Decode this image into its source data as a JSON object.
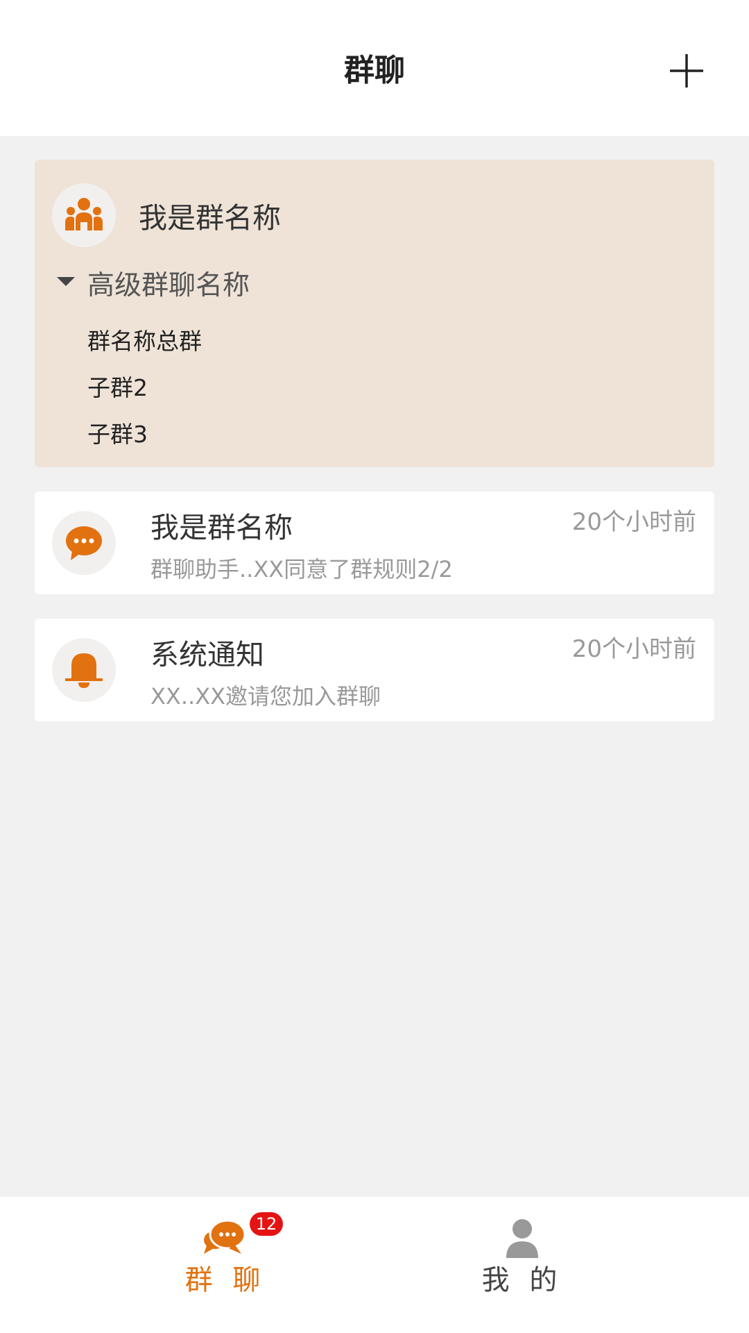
{
  "header": {
    "title": "群聊"
  },
  "group_card": {
    "name": "我是群名称",
    "tree_title": "高级群聊名称",
    "sub_groups": [
      "群名称总群",
      "子群2",
      "子群3"
    ]
  },
  "conversations": [
    {
      "title": "我是群名称",
      "subtitle": "群聊助手..XX同意了群规则2/2",
      "time": "20个小时前",
      "icon": "chat-bubble-icon"
    },
    {
      "title": "系统通知",
      "subtitle": "XX..XX邀请您加入群聊",
      "time": "20个小时前",
      "icon": "bell-icon"
    }
  ],
  "tabbar": {
    "chat_label": "群 聊",
    "chat_badge": "12",
    "me_label": "我 的"
  },
  "colors": {
    "accent": "#e2710f",
    "badge": "#e51414",
    "group_card_bg": "#efe3d8",
    "page_bg": "#f1f1f1"
  }
}
